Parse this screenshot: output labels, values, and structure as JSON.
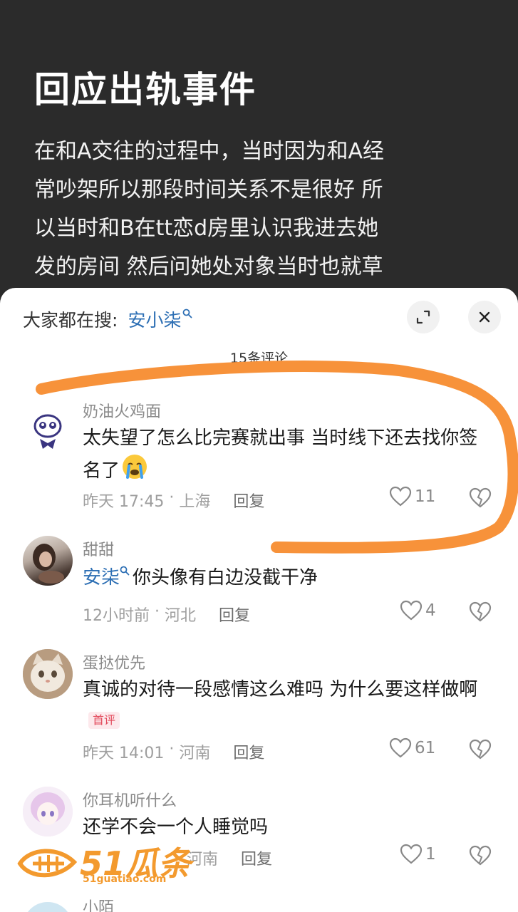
{
  "post": {
    "title": "回应出轨事件",
    "body_lines": [
      "在和A交往的过程中，当时因为和A经",
      "常吵架所以那段时间关系不是很好 所",
      "以当时和B在tt恋d房里认识我进去她",
      "发的房间 然后问她处对象当时也就草"
    ]
  },
  "sheet": {
    "search_prefix": "大家都在搜:",
    "search_term": "安小柒",
    "comment_count": "15条评论"
  },
  "comments": [
    {
      "username": "奶油火鸡面",
      "text": "太失望了怎么比完赛就出事 当时线下还去找你签名了",
      "time": "昨天 17:45",
      "location": "上海",
      "reply_label": "回复",
      "likes": "11"
    },
    {
      "username": "甜甜",
      "mention": "安柒",
      "text": "你头像有白边没截干净",
      "time": "12小时前",
      "location": "河北",
      "reply_label": "回复",
      "likes": "4"
    },
    {
      "username": "蛋挞优先",
      "text": "真诚的对待一段感情这么难吗 为什么要这样做啊",
      "badge": "首评",
      "time": "昨天 14:01",
      "location": "河南",
      "reply_label": "回复",
      "likes": "61"
    },
    {
      "username": "你耳机听什么",
      "text": "还学不会一个人睡觉吗",
      "location": "河南",
      "reply_label": "回复",
      "likes": "1"
    },
    {
      "username": "小陌"
    }
  ],
  "watermark": {
    "brand": "51瓜条",
    "url": "51guatiao.com"
  },
  "colors": {
    "accent_blue": "#2d6fb4",
    "annotation_orange": "#f7923a",
    "badge_red": "#e24a5b"
  }
}
